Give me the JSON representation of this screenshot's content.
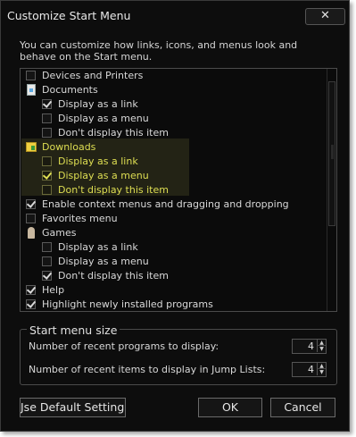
{
  "window": {
    "title": "Customize Start Menu",
    "close_glyph": "✕",
    "description": "You can customize how links, icons, and menus look and behave on the Start menu."
  },
  "list": {
    "items": [
      {
        "label": "Devices and Printers",
        "kind": "checkbox",
        "checked": false,
        "icon": "checkbox"
      },
      {
        "label": "Documents",
        "kind": "heading",
        "icon": "documents-icon"
      },
      {
        "label": "Display as a link",
        "kind": "option",
        "checked": true
      },
      {
        "label": "Display as a menu",
        "kind": "option",
        "checked": false
      },
      {
        "label": "Don't display this item",
        "kind": "option",
        "checked": false
      },
      {
        "label": "Downloads",
        "kind": "heading",
        "icon": "downloads-folder-icon",
        "highlighted": true
      },
      {
        "label": "Display as a link",
        "kind": "option",
        "checked": false,
        "highlighted": true
      },
      {
        "label": "Display as a menu",
        "kind": "option",
        "checked": true,
        "highlighted": true
      },
      {
        "label": "Don't display this item",
        "kind": "option",
        "checked": false,
        "highlighted": true
      },
      {
        "label": "Enable context menus and dragging and dropping",
        "kind": "checkbox",
        "checked": true
      },
      {
        "label": "Favorites menu",
        "kind": "checkbox",
        "checked": false
      },
      {
        "label": "Games",
        "kind": "heading",
        "icon": "games-icon"
      },
      {
        "label": "Display as a link",
        "kind": "option",
        "checked": false
      },
      {
        "label": "Display as a menu",
        "kind": "option",
        "checked": false
      },
      {
        "label": "Don't display this item",
        "kind": "option",
        "checked": true
      },
      {
        "label": "Help",
        "kind": "checkbox",
        "checked": true
      },
      {
        "label": "Highlight newly installed programs",
        "kind": "checkbox",
        "checked": true
      }
    ]
  },
  "size_group": {
    "legend": "Start menu size",
    "recent_programs_label": "Number of recent programs to display:",
    "recent_programs_value": "4",
    "jump_list_label": "Number of recent items to display in Jump Lists:",
    "jump_list_value": "4",
    "spin_up_glyph": "▲",
    "spin_down_glyph": "▼"
  },
  "buttons": {
    "default_settings": "Jse Default Setting:",
    "ok": "OK",
    "cancel": "Cancel"
  },
  "colors": {
    "background": "#0d0d0d",
    "text": "#d8d8d8",
    "highlight_text": "#dede52",
    "highlight_bg": "#232315"
  }
}
